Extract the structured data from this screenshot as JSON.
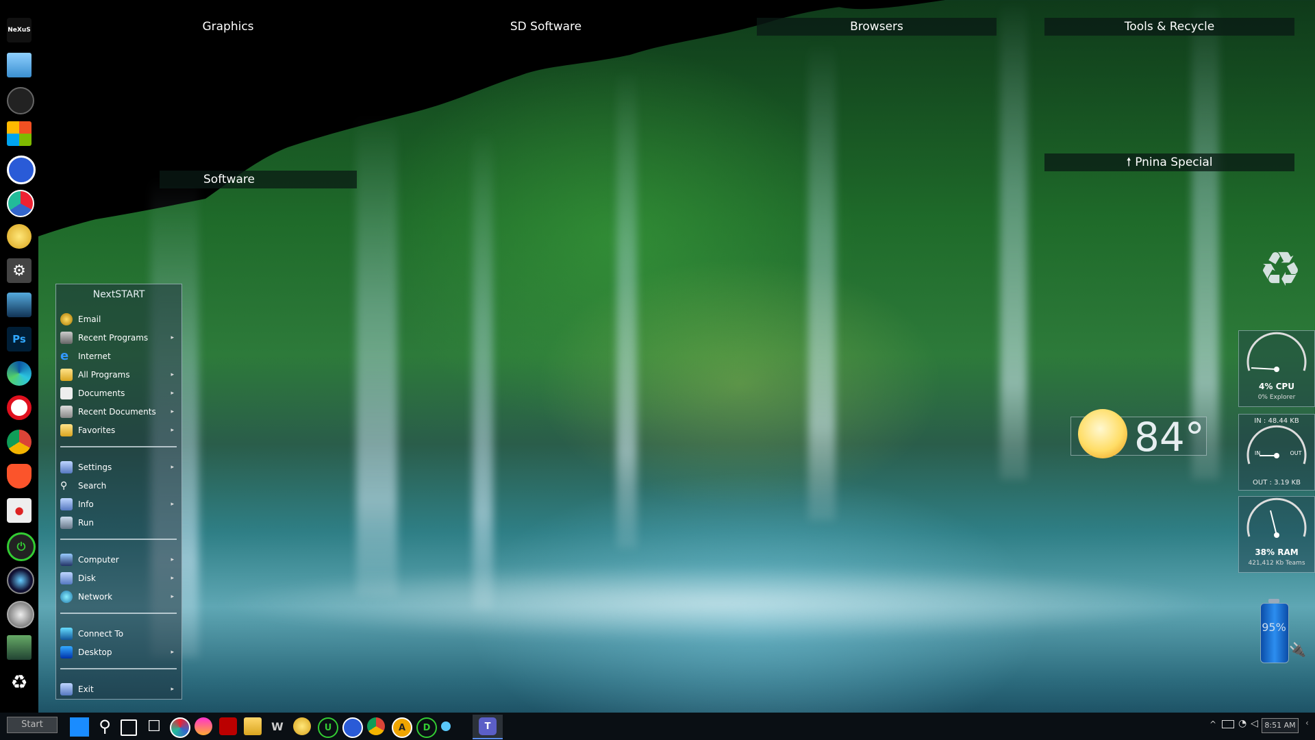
{
  "desktop": {
    "fences": {
      "graphics": "Graphics",
      "sd_software": "SD Software",
      "browsers": "Browsers",
      "tools_recycle": "Tools & Recycle",
      "software": "Software",
      "pnina_special": "Pnina Special",
      "pnina_arrow": "🠕"
    }
  },
  "dock": {
    "logo": "NeXuS",
    "ps_label": "Ps"
  },
  "start_menu": {
    "title": "NextSTART",
    "items": [
      {
        "label": "Email",
        "icon": "email-icon",
        "submenu": false
      },
      {
        "label": "Recent Programs",
        "icon": "recent-programs-icon",
        "submenu": true
      },
      {
        "label": "Internet",
        "icon": "ie-icon",
        "submenu": false
      },
      {
        "label": "All Programs",
        "icon": "folder-icon",
        "submenu": true
      },
      {
        "label": "Documents",
        "icon": "documents-icon",
        "submenu": true
      },
      {
        "label": "Recent Documents",
        "icon": "recent-documents-icon",
        "submenu": true
      },
      {
        "label": "Favorites",
        "icon": "favorites-folder-icon",
        "submenu": true
      },
      {
        "label": "Settings",
        "icon": "settings-icon",
        "submenu": true
      },
      {
        "label": "Search",
        "icon": "search-icon",
        "submenu": false
      },
      {
        "label": "Info",
        "icon": "info-icon",
        "submenu": true
      },
      {
        "label": "Run",
        "icon": "run-icon",
        "submenu": false
      },
      {
        "label": "Computer",
        "icon": "computer-icon",
        "submenu": true
      },
      {
        "label": "Disk",
        "icon": "disk-icon",
        "submenu": true
      },
      {
        "label": "Network",
        "icon": "network-icon",
        "submenu": true
      },
      {
        "label": "Connect To",
        "icon": "connect-icon",
        "submenu": false
      },
      {
        "label": "Desktop",
        "icon": "desktop-icon",
        "submenu": true
      },
      {
        "label": "Exit",
        "icon": "exit-icon",
        "submenu": true
      }
    ]
  },
  "weather": {
    "temperature": "84°"
  },
  "gauges": {
    "cpu": {
      "value": "4% CPU",
      "sub": "0% Explorer",
      "level": 0.04
    },
    "network": {
      "in": "IN : 48.44 KB",
      "out": "OUT : 3.19 KB",
      "in_lbl": "IN",
      "out_lbl": "OUT"
    },
    "ram": {
      "value": "38% RAM",
      "sub": "421,412 Kb Teams",
      "level": 0.38
    }
  },
  "battery": {
    "percent": "95%",
    "level": 0.95
  },
  "taskbar": {
    "start_label": "Start",
    "clock": "8:51 AM",
    "tray_chevron": "^"
  },
  "colors": {
    "accent": "#0a78d4",
    "dock_bg": "#000000",
    "taskbar_bg": "#0a0f14"
  }
}
